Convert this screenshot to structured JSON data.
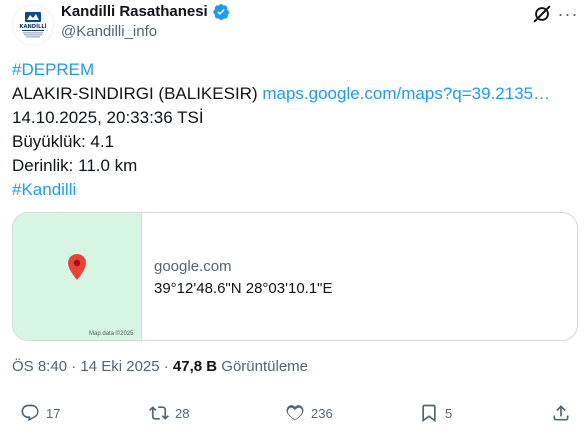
{
  "author": {
    "name": "Kandilli Rasathanesi",
    "handle": "@Kandilli_info",
    "logo_text": "KANDİLLİ",
    "logo_subtext": "RASATHANESİ VE DEPREM ARAŞTIRMA ENSTİTÜSÜ",
    "verified_color": "#1d9bf0"
  },
  "tweet": {
    "hashtag1": "#DEPREM",
    "location": "ALAKIR-SINDIRGI (BALIKESIR) ",
    "link": "maps.google.com/maps?q=39.2135…",
    "datetime": "14.10.2025, 20:33:36 TSİ",
    "magnitude": "Büyüklük: 4.1",
    "depth": "Derinlik: 11.0 km",
    "hashtag2": "#Kandilli"
  },
  "card": {
    "domain": "google.com",
    "title": "39°12'48.6\"N 28°03'10.1\"E",
    "map_attribution": "Map data ©2025"
  },
  "meta": {
    "time": "ÖS 8:40 · 14 Eki 2025 · ",
    "views_count": "47,8 B",
    "views_label": " Görüntüleme"
  },
  "actions": {
    "replies": "17",
    "retweets": "28",
    "likes": "236",
    "bookmarks": "5"
  },
  "colors": {
    "accent": "#1d9bf0",
    "secondary_text": "#536471",
    "map_bg": "#d7f5e3",
    "pin": "#ea4335"
  },
  "icons": [
    "verified-badge-icon",
    "grok-icon",
    "more-icon",
    "map-pin-icon",
    "reply-icon",
    "retweet-icon",
    "like-icon",
    "bookmark-icon",
    "share-icon"
  ]
}
